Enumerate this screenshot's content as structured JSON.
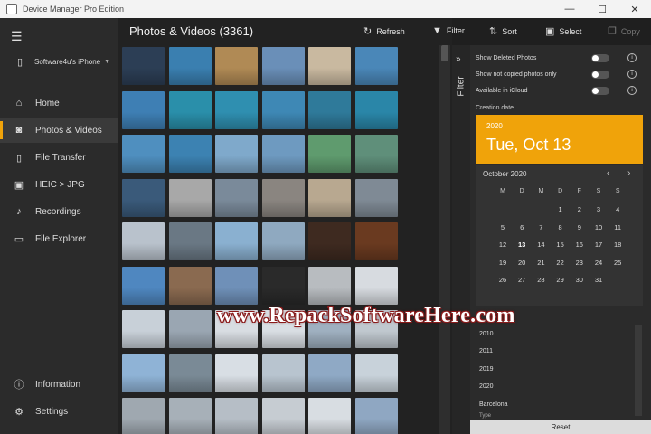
{
  "window": {
    "title": "Device Manager Pro Edition",
    "controls": [
      "—",
      "☐",
      "✕"
    ]
  },
  "sidebar": {
    "menu_icon": "hamburger-icon",
    "device": {
      "name": "Software4u's iPhone",
      "icon": "phone-icon"
    },
    "items": [
      {
        "label": "Home",
        "icon": "home-icon",
        "active": false
      },
      {
        "label": "Photos & Videos",
        "icon": "camera-icon",
        "active": true
      },
      {
        "label": "File Transfer",
        "icon": "phone-icon",
        "active": false
      },
      {
        "label": "HEIC > JPG",
        "icon": "image-icon",
        "active": false
      },
      {
        "label": "Recordings",
        "icon": "mic-icon",
        "active": false
      },
      {
        "label": "File Explorer",
        "icon": "folder-icon",
        "active": false
      }
    ],
    "bottom": [
      {
        "label": "Information",
        "icon": "info-icon"
      },
      {
        "label": "Settings",
        "icon": "gear-icon"
      }
    ]
  },
  "main": {
    "title": "Photos & Videos (3361)",
    "toolbar": {
      "refresh": "Refresh",
      "filter": "Filter",
      "sort": "Sort",
      "select": "Select",
      "copy": "Copy"
    }
  },
  "filter": {
    "tab_label": "Filter",
    "toggles": [
      {
        "label": "Show Deleted Photos",
        "on": false
      },
      {
        "label": "Show not copied photos only",
        "on": false
      },
      {
        "label": "Available in iCloud",
        "on": false
      }
    ],
    "creation_date_label": "Creation date",
    "selected_year": "2020",
    "selected_date": "Tue, Oct 13",
    "calendar": {
      "month": "October 2020",
      "dow": [
        "M",
        "D",
        "M",
        "D",
        "F",
        "S",
        "S"
      ],
      "weeks": [
        [
          "",
          "",
          "",
          "1",
          "2",
          "3",
          "4"
        ],
        [
          "5",
          "6",
          "7",
          "8",
          "9",
          "10",
          "11"
        ],
        [
          "12",
          "13",
          "14",
          "15",
          "16",
          "17",
          "18"
        ],
        [
          "19",
          "20",
          "21",
          "22",
          "23",
          "24",
          "25"
        ],
        [
          "26",
          "27",
          "28",
          "29",
          "30",
          "31",
          ""
        ]
      ],
      "selected_day": "13"
    },
    "years": [
      "2010",
      "2011",
      "2019",
      "2020"
    ],
    "location": "Barcelona",
    "type_label": "Type",
    "reset": "Reset"
  },
  "watermark": "www.RepackSoftwareHere.com",
  "thumbnail_palette": [
    [
      "#2c3e55",
      "#3a7fb0",
      "#b08a55",
      "#6a8fb8",
      "#c9b9a0",
      "#4a87b8"
    ],
    [
      "#3e7fb4",
      "#2a8faa",
      "#2f8fb0",
      "#3e88b5",
      "#2f7a9a",
      "#2a86a8"
    ],
    [
      "#4f8fbf",
      "#3c82b2",
      "#7fa9cb",
      "#6e9ac0",
      "#5f9b6e",
      "#5f8f7a"
    ],
    [
      "#3a5a7a",
      "#a8a8a8",
      "#7a8a9a",
      "#8a8580",
      "#b8a890",
      "#7f8a95"
    ],
    [
      "#b9c2cc",
      "#6a7884",
      "#8ab0d0",
      "#8fa9c0",
      "#3e2a20",
      "#6a3a20"
    ],
    [
      "#4f87c0",
      "#8a6a50",
      "#6f90b8",
      "#2a2a2a",
      "#b8bcc0",
      "#d7dbe0"
    ],
    [
      "#c8d0d8",
      "#9aa6b2",
      "#d8dde2",
      "#d9dee3",
      "#9fb0c0",
      "#c0c8cf"
    ],
    [
      "#8fb3d6",
      "#7a8a96",
      "#d8dee4",
      "#b8c4cf",
      "#8fa9c5",
      "#c8d2da"
    ],
    [
      "#9fa8b0",
      "#a7b0b8",
      "#b6bec6",
      "#c6ccd2",
      "#d8dde2",
      "#8fa7c2"
    ]
  ]
}
